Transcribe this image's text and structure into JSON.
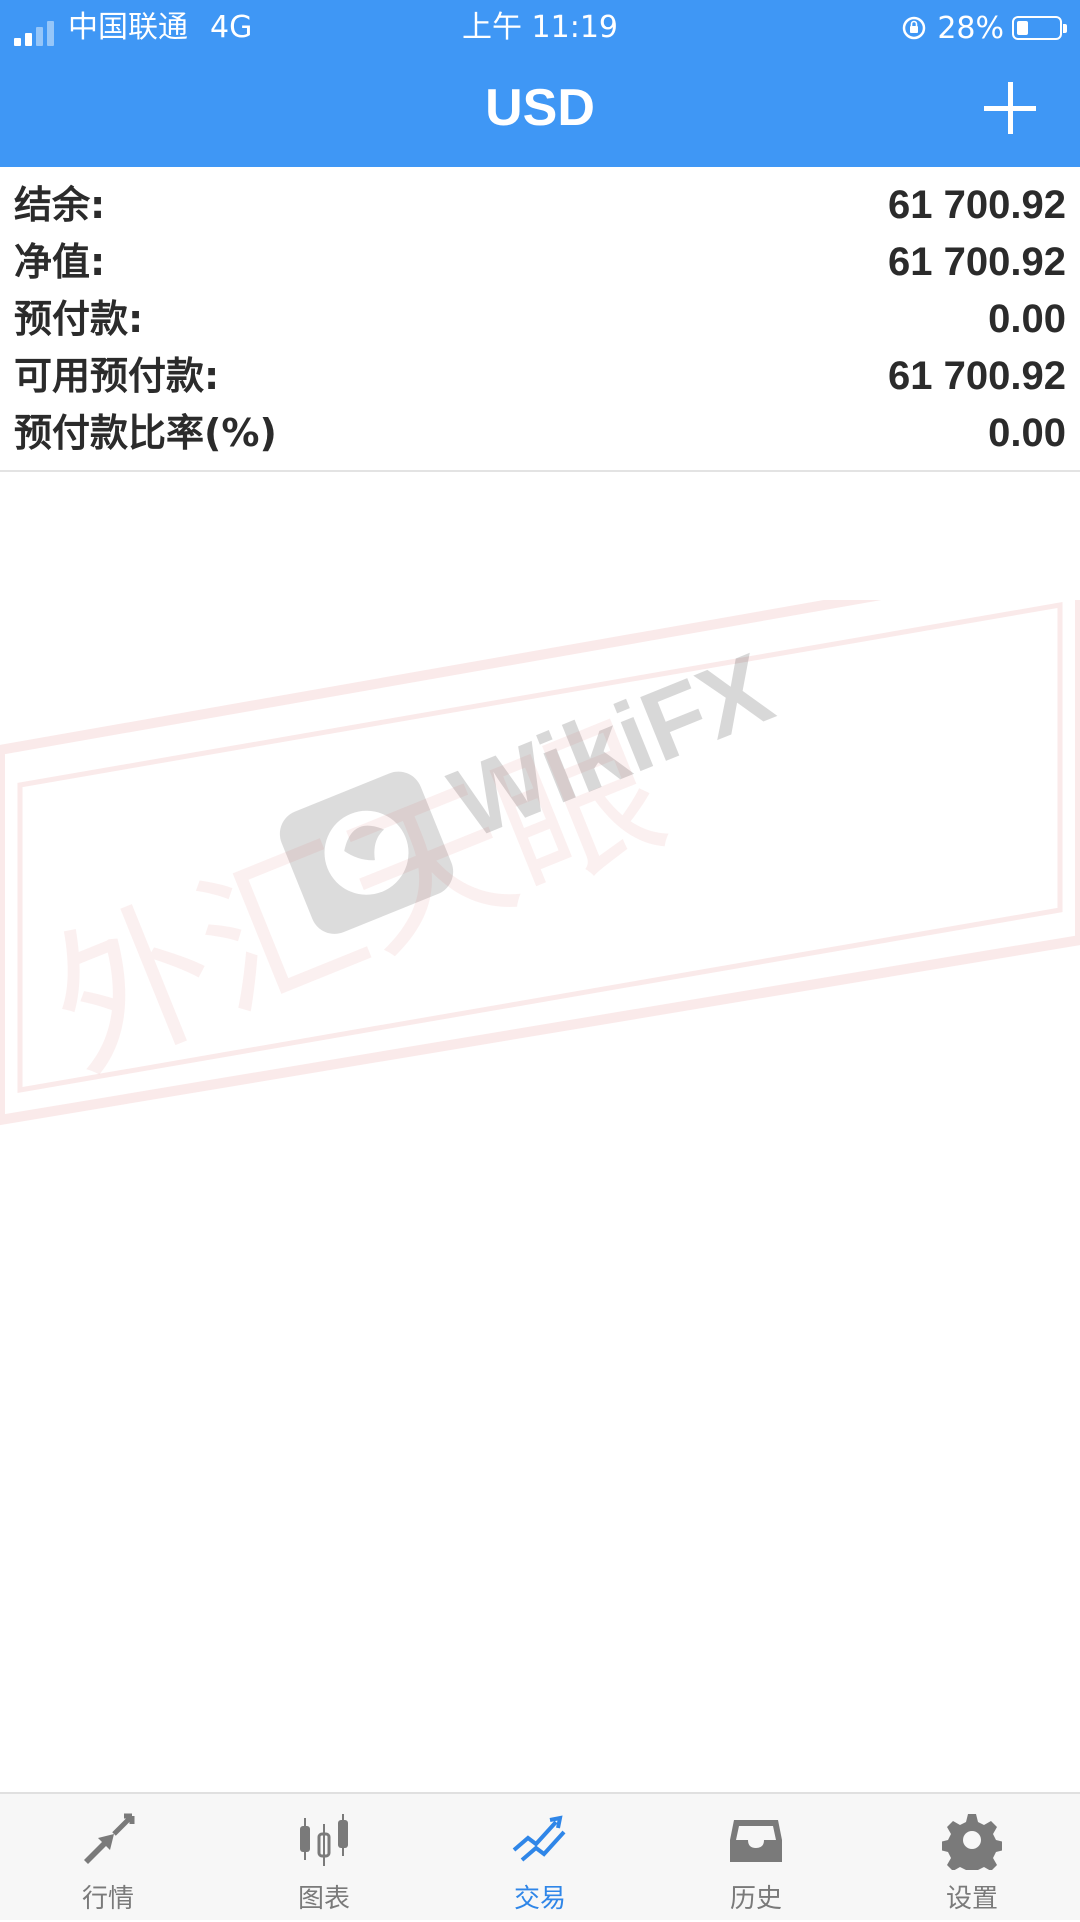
{
  "status_bar": {
    "carrier": "中国联通",
    "network": "4G",
    "time": "上午 11:19",
    "battery": "28%",
    "battery_level": 0.28
  },
  "header": {
    "title": "USD",
    "add_icon": "plus-icon"
  },
  "summary": [
    {
      "label": "结余:",
      "value": "61 700.92"
    },
    {
      "label": "净值:",
      "value": "61 700.92"
    },
    {
      "label": "预付款:",
      "value": "0.00"
    },
    {
      "label": "可用预付款:",
      "value": "61 700.92"
    },
    {
      "label": "预付款比率(%)",
      "value": "0.00"
    }
  ],
  "watermark": {
    "text": "WikiFX",
    "logo_text": "外汇天眼"
  },
  "tab_bar": {
    "active": "交易",
    "tabs": [
      {
        "label": "行情",
        "icon": "quotes-arrows-icon"
      },
      {
        "label": "图表",
        "icon": "candlestick-icon"
      },
      {
        "label": "交易",
        "icon": "trade-trend-icon"
      },
      {
        "label": "历史",
        "icon": "inbox-history-icon"
      },
      {
        "label": "设置",
        "icon": "gear-icon"
      }
    ]
  },
  "colors": {
    "header": "#3f97f5",
    "active_tab": "#2f86e8",
    "inactive_tab": "#7a7a7a"
  }
}
